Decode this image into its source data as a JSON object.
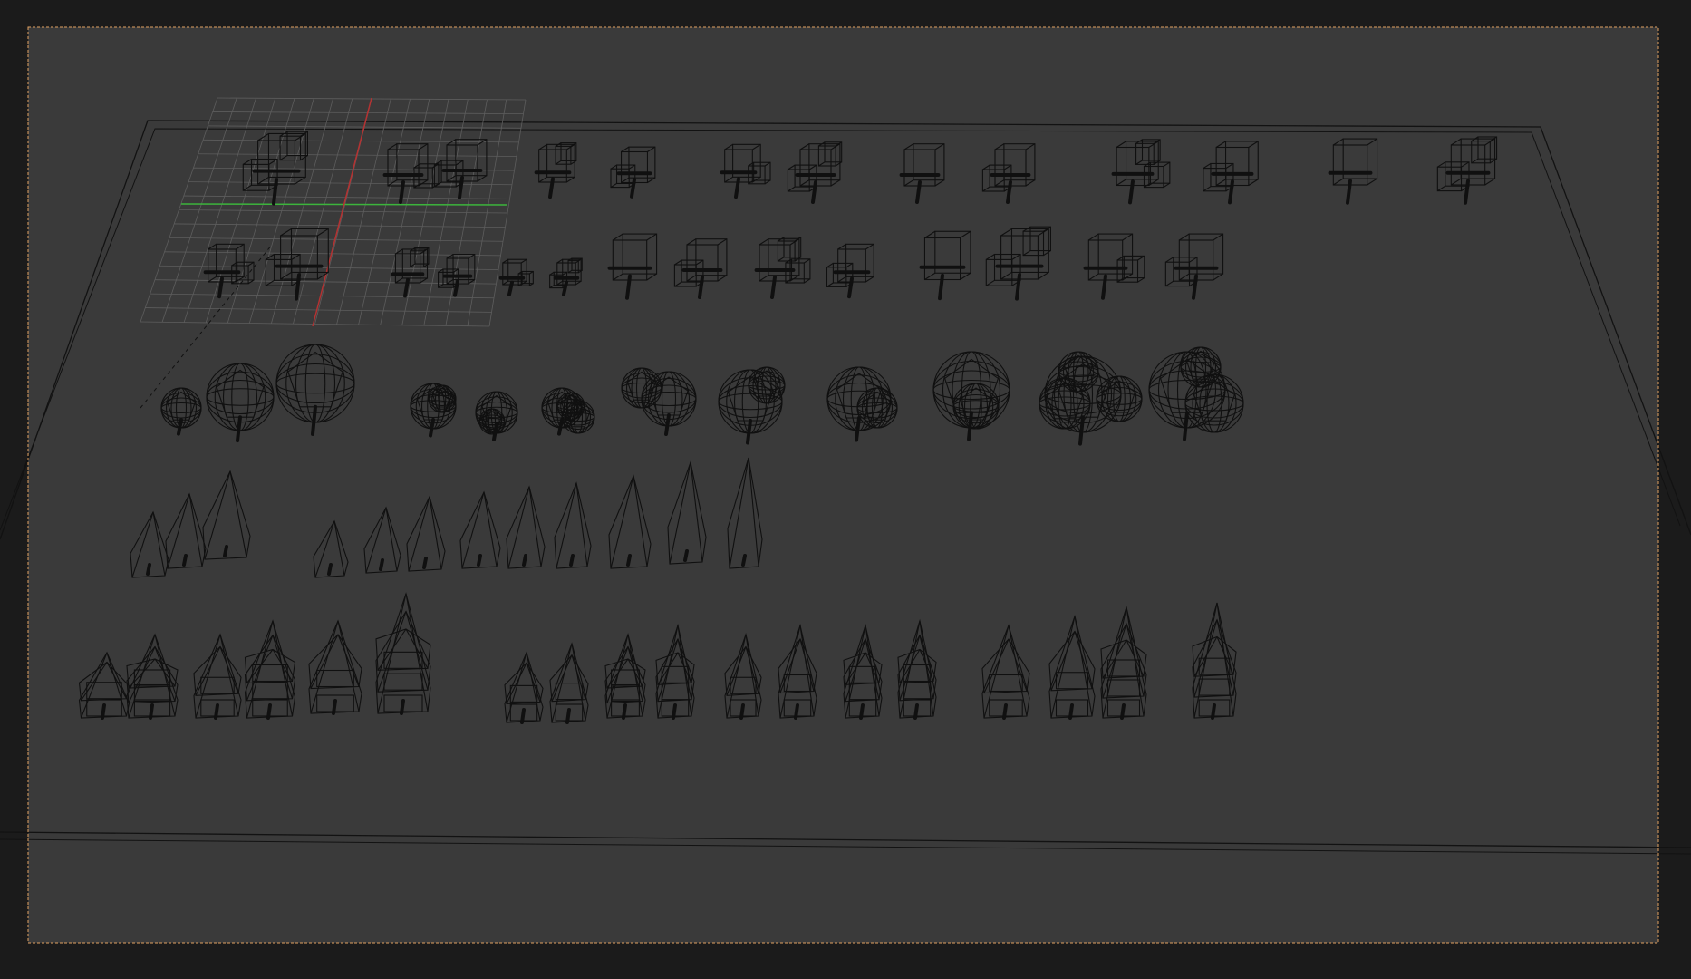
{
  "app": {
    "window_title": ""
  },
  "viewport": {
    "background_color": "#1b1b1b",
    "camera_frame_color": "#3a3a3a",
    "camera_border_color": "#e0a060",
    "wire_color": "#101010",
    "grid_color": "#5d5d5d",
    "axis_x_color": "#c83232",
    "axis_y_color": "#32b432",
    "shading_mode": "wireframe"
  },
  "scene": {
    "row_box_trees_large_count": 11,
    "row_box_trees_small_count": 10,
    "row_sphere_trees_count": 11,
    "row_cone_trees_count": 12,
    "row_layered_cone_trees_count": 16
  }
}
